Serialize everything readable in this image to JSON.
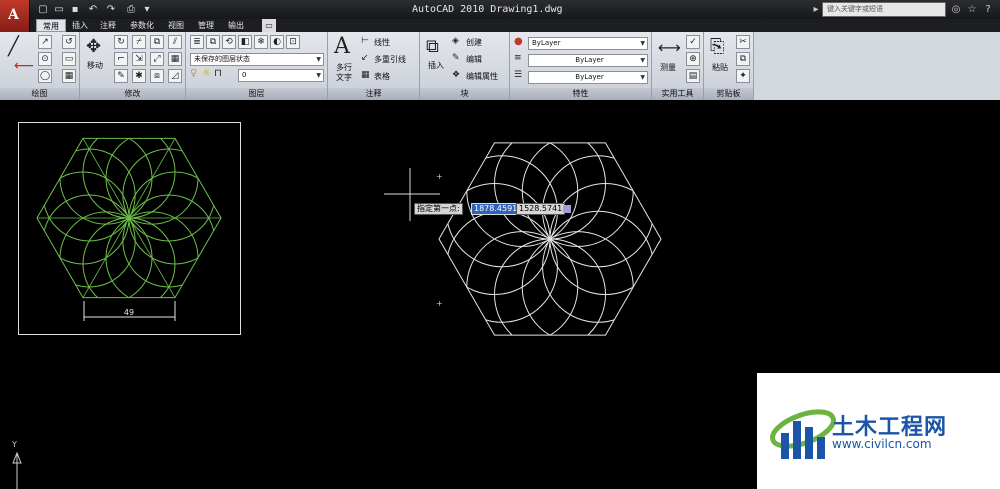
{
  "window": {
    "title": "AutoCAD 2010   Drawing1.dwg",
    "logo": "A",
    "search_placeholder": "键入关键字或短语"
  },
  "tabs": [
    {
      "label": "常用",
      "active": true
    },
    {
      "label": "插入"
    },
    {
      "label": "注释"
    },
    {
      "label": "参数化"
    },
    {
      "label": "视图"
    },
    {
      "label": "管理"
    },
    {
      "label": "输出"
    }
  ],
  "ribbon": {
    "panels": {
      "draw": "绘图",
      "modify": "修改",
      "layers": "图层",
      "annotation": "注释",
      "block": "块",
      "properties": "特性",
      "utilities": "实用工具",
      "clipboard": "剪贴板"
    },
    "modify": {
      "move_label": "移动"
    },
    "layers": {
      "state_combo": "未保存的图层状态",
      "layer_combo": "0"
    },
    "annotation": {
      "mtext_label_1": "多行",
      "mtext_label_2": "文字",
      "linear": "线性",
      "multileader": "多重引线",
      "table": "表格"
    },
    "block": {
      "insert": "插入",
      "create": "创建",
      "edit": "编辑",
      "edit_attributes": "编辑属性"
    },
    "properties": {
      "color": "ByLayer",
      "linetype": "ByLayer",
      "lineweight": "ByLayer"
    },
    "utilities": {
      "measure": "测量"
    },
    "clipboard": {
      "paste": "粘贴"
    }
  },
  "drawing": {
    "dimension_text": "49",
    "tooltip_prompt": "指定第一点:",
    "tooltip_x": "1878.4591",
    "tooltip_y": "1528.5741",
    "ucs_label": "Y"
  },
  "watermark": {
    "name": "土木工程网",
    "url": "www.civilcn.com"
  },
  "colors": {
    "accent_red": "#c0392b",
    "reference_green": "#6dbf4a",
    "drawing_white": "#e6e6e6",
    "tooltip_blue": "#2d63b9",
    "watermark_blue": "#1a55a8"
  }
}
